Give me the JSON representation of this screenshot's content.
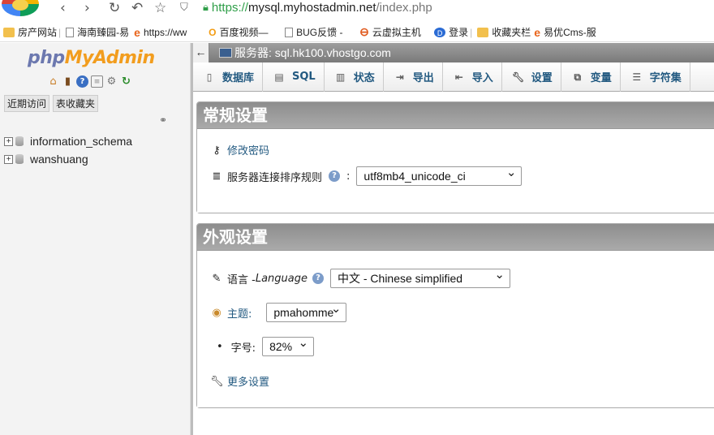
{
  "browser": {
    "url_scheme": "https://",
    "url_host": "mysql.myhostadmin.net",
    "url_path": "/index.php",
    "bookmarks": [
      {
        "label": "房产网站",
        "icon": "folder-icon"
      },
      {
        "label": "海南臻园-易",
        "icon": "page-icon"
      },
      {
        "label": "https://ww",
        "icon": "e-icon"
      },
      {
        "label": "百度视频—",
        "icon": "o-icon"
      },
      {
        "label": "BUG反馈 -",
        "icon": "page-icon"
      },
      {
        "label": "云虚拟主机",
        "icon": "cloud-icon"
      },
      {
        "label": "登录",
        "icon": "d-icon"
      },
      {
        "label": "收藏夹栏",
        "icon": "folder-icon"
      },
      {
        "label": "易优Cms-服",
        "icon": "e-icon"
      }
    ]
  },
  "sidebar": {
    "logo": {
      "php": "php",
      "my": "My",
      "admin": "Admin"
    },
    "tabs": [
      "近期访问",
      "表收藏夹"
    ],
    "databases": [
      "information_schema",
      "wanshuang"
    ]
  },
  "server_bar": {
    "label": "服务器: sql.hk100.vhostgo.com"
  },
  "topmenu": [
    {
      "label": "数据库",
      "icon": "database-icon"
    },
    {
      "label": "SQL",
      "icon": "sql-icon"
    },
    {
      "label": "状态",
      "icon": "status-icon"
    },
    {
      "label": "导出",
      "icon": "export-icon"
    },
    {
      "label": "导入",
      "icon": "import-icon"
    },
    {
      "label": "设置",
      "icon": "wrench-icon"
    },
    {
      "label": "变量",
      "icon": "variables-icon"
    },
    {
      "label": "字符集",
      "icon": "charset-icon"
    }
  ],
  "general": {
    "title": "常规设置",
    "change_password": "修改密码",
    "collation_label": "服务器连接排序规则",
    "collation_colon": ":",
    "collation_value": "utf8mb4_unicode_ci"
  },
  "appearance": {
    "title": "外观设置",
    "language_label": "语言 - ",
    "language_label_en": "Language",
    "language_value": "中文 - Chinese simplified",
    "theme_label": "主题:",
    "theme_value": "pmahomme",
    "fontsize_label": "字号:",
    "fontsize_value": "82%",
    "more_settings": "更多设置"
  }
}
